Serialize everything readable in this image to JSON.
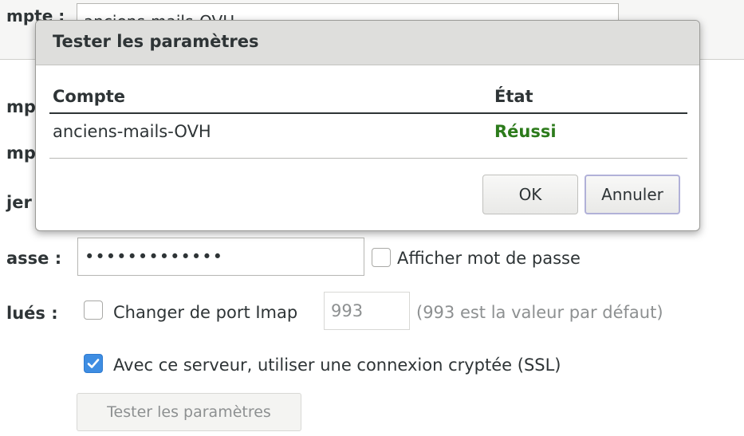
{
  "form": {
    "account_field_label": "mpte :",
    "account_value": "anciens-mails-OVH",
    "row2_label": "mpt",
    "row3_label": "mpt",
    "row4_label": "jer",
    "password_label": "asse :",
    "password_value": "•••••••••••••",
    "show_password_label": "Afficher mot de passe",
    "advanced_label": "lués :",
    "change_port_label": "Changer de port Imap",
    "port_value": "993",
    "port_hint": "(993 est la valeur par défaut)",
    "ssl_label": "Avec ce serveur, utiliser une connexion cryptée (SSL)",
    "ssl_checked": true,
    "test_button_label": "Tester les paramètres"
  },
  "dialog": {
    "title": "Tester les paramètres",
    "columns": [
      "Compte",
      "État"
    ],
    "rows": [
      {
        "account": "anciens-mails-OVH",
        "status": "Réussi"
      }
    ],
    "ok_label": "OK",
    "cancel_label": "Annuler"
  },
  "colors": {
    "success": "#2c7b1b",
    "checkbox_checked": "#3e8de2"
  }
}
